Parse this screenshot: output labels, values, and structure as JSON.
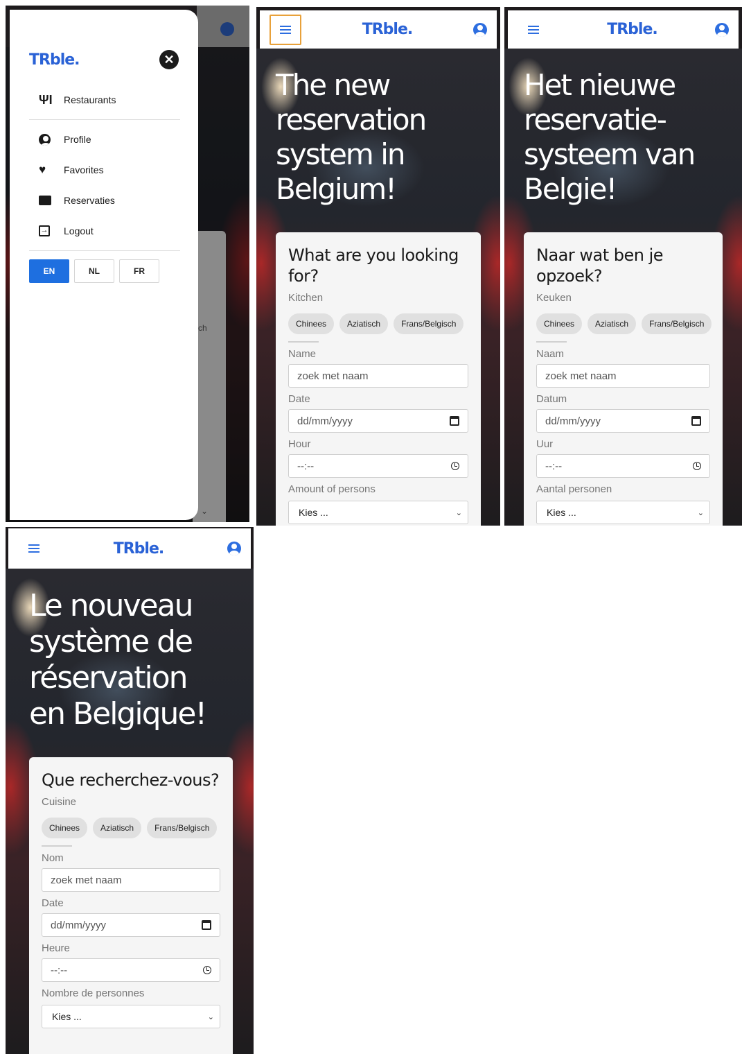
{
  "brand": {
    "logo": "TRble.",
    "accent": "#2a62d6"
  },
  "drawer": {
    "close_label": "✕",
    "items": [
      {
        "label": "Restaurants",
        "icon": "utensils-icon"
      },
      {
        "label": "Profile",
        "icon": "user-circle-icon"
      },
      {
        "label": "Favorites",
        "icon": "heart-icon"
      },
      {
        "label": "Reservaties",
        "icon": "ticket-icon"
      },
      {
        "label": "Logout",
        "icon": "logout-icon"
      }
    ],
    "languages": [
      "EN",
      "NL",
      "FR"
    ],
    "active_language": "EN",
    "ghost_chip": "ch",
    "ghost_select_chevron": "⌄"
  },
  "en": {
    "hero": [
      "The new",
      "reservation",
      "system in",
      "Belgium!"
    ],
    "card_title": "What are you looking for?",
    "kitchen_label": "Kitchen",
    "chips": [
      "Chinees",
      "Aziatisch",
      "Frans/Belgisch"
    ],
    "name_label": "Name",
    "name_placeholder": "zoek met naam",
    "date_label": "Date",
    "date_placeholder": "dd/mm/yyyy",
    "hour_label": "Hour",
    "hour_placeholder": "--:--",
    "persons_label": "Amount of persons",
    "persons_value": "Kies ..."
  },
  "nl": {
    "hero": [
      "Het nieuwe",
      "reservatie-",
      "systeem van",
      "Belgie!"
    ],
    "card_title": "Naar wat ben je opzoek?",
    "kitchen_label": "Keuken",
    "chips": [
      "Chinees",
      "Aziatisch",
      "Frans/Belgisch"
    ],
    "name_label": "Naam",
    "name_placeholder": "zoek met naam",
    "date_label": "Datum",
    "date_placeholder": "dd/mm/yyyy",
    "hour_label": "Uur",
    "hour_placeholder": "--:--",
    "persons_label": "Aantal personen",
    "persons_value": "Kies ..."
  },
  "fr": {
    "hero": [
      "Le nouveau",
      "système de",
      "réservation",
      "en Belgique!"
    ],
    "card_title": "Que recherchez-vous?",
    "kitchen_label": "Cuisine",
    "chips": [
      "Chinees",
      "Aziatisch",
      "Frans/Belgisch"
    ],
    "name_label": "Nom",
    "name_placeholder": "zoek met naam",
    "date_label": "Date",
    "date_placeholder": "dd/mm/yyyy",
    "hour_label": "Heure",
    "hour_placeholder": "--:--",
    "persons_label": "Nombre de personnes",
    "persons_value": "Kies ..."
  },
  "colors": {
    "primary": "#1e6fe0",
    "focus_ring": "#e8a13a",
    "card_bg": "#f5f5f5"
  }
}
